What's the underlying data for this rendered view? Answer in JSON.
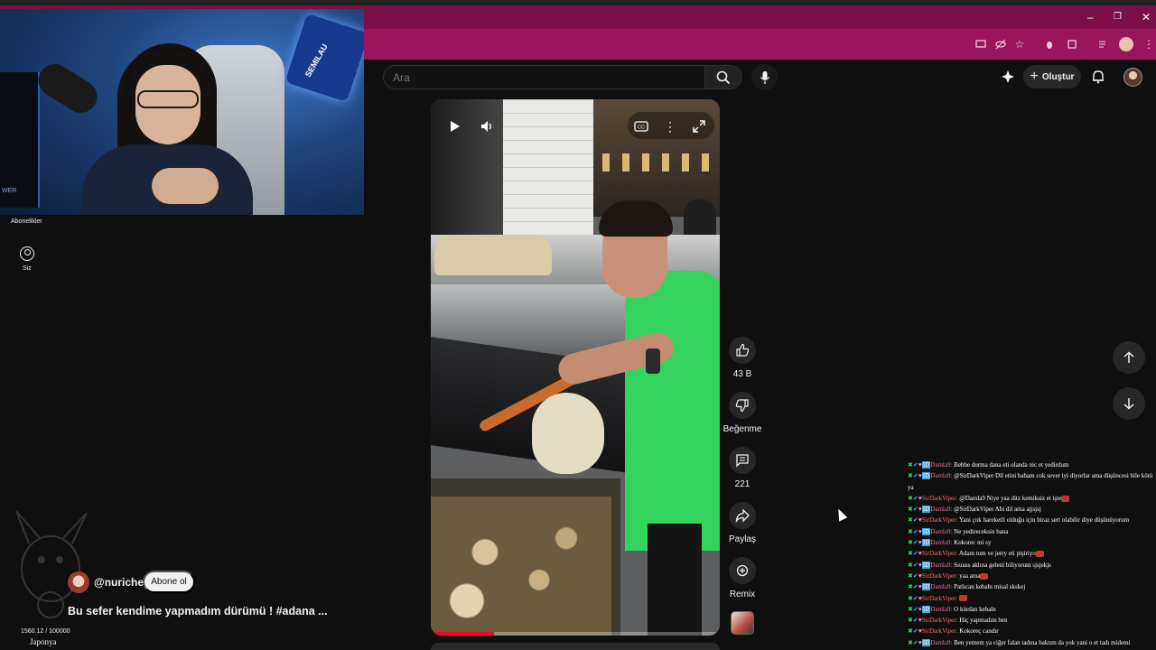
{
  "browser": {
    "window_controls": {
      "minimize": "–",
      "restore": "❐",
      "close": "✕"
    }
  },
  "webcam": {
    "logo_text": "SEMILAU",
    "chair_text": "au",
    "pc_text": "WER"
  },
  "left_rail": {
    "subscriptions_label": "Abonelikler",
    "you_label": "Siz"
  },
  "header": {
    "search_placeholder": "Ara",
    "create_label": "Oluştur"
  },
  "short": {
    "progress": 0.22,
    "channel": "@nurichef",
    "subscribe_label": "Abone ol",
    "title": "Bu sefer kendime yapmadım dürümü ! #adana ..."
  },
  "actions": {
    "like_count": "43 B",
    "dislike_label": "Beğenme",
    "comment_count": "221",
    "share_label": "Paylaş",
    "remix_label": "Remix"
  },
  "overlay": {
    "stat": "1560.12 / 100000",
    "location": "Japonya"
  },
  "chat": [
    {
      "user": "Damla9:",
      "cls": "u-damla",
      "msg": "Bebbe dorma dana eti olanda nic et yedirdum",
      "emote": false
    },
    {
      "user": "Damla9:",
      "cls": "u-damla",
      "msg": "@SirDarkViper Dil etini babam cok sever iyi diyorlar ama düşüncesi bile kötü ya",
      "emote": false
    },
    {
      "user": "SirDarkViper:",
      "cls": "u-sir",
      "msg": "@Damla9 Niye yaa ditz kemiksiz et işte",
      "emote": true
    },
    {
      "user": "Damla9:",
      "cls": "u-damla",
      "msg": "@SirDarkViper Abi dil ama ajjsjsj",
      "emote": false
    },
    {
      "user": "SirDarkViper:",
      "cls": "u-sir",
      "msg": "Yani çok hareketli olduğu için biraz sert olabilir diye düşünüyorum",
      "emote": false
    },
    {
      "user": "Damla9:",
      "cls": "u-damla",
      "msg": "Ne yedireceksin bana",
      "emote": false
    },
    {
      "user": "Damla9:",
      "cls": "u-damla",
      "msg": "Kokorec mi sy",
      "emote": false
    },
    {
      "user": "SirDarkViper:",
      "cls": "u-sir",
      "msg": "Adam tom ve jerry eti pişiriyo",
      "emote": true
    },
    {
      "user": "Damla9:",
      "cls": "u-damla",
      "msg": "Sıuuss aklına geleni biliyorum sjsjekjs",
      "emote": false
    },
    {
      "user": "SirDarkViper:",
      "cls": "u-sir",
      "msg": "yaa ama",
      "emote": true
    },
    {
      "user": "Damla9:",
      "cls": "u-damla",
      "msg": "Patlıcan kebabı misal skskej",
      "emote": false
    },
    {
      "user": "SirDarkViper:",
      "cls": "u-sir",
      "msg": "",
      "emote": true
    },
    {
      "user": "Damla9:",
      "cls": "u-damla",
      "msg": "O kürdan kebabı",
      "emote": false
    },
    {
      "user": "SirDarkViper:",
      "cls": "u-sir",
      "msg": "Hiç yapmadım ben",
      "emote": false
    },
    {
      "user": "SirDarkViper:",
      "cls": "u-sir",
      "msg": "Kokoreç candır",
      "emote": false
    },
    {
      "user": "Damla9:",
      "cls": "u-damla",
      "msg": "Ben yemem ya ciğer falan tadına baktım da yok yani o et tadı midemi bulandırıyor",
      "emote": false
    }
  ]
}
